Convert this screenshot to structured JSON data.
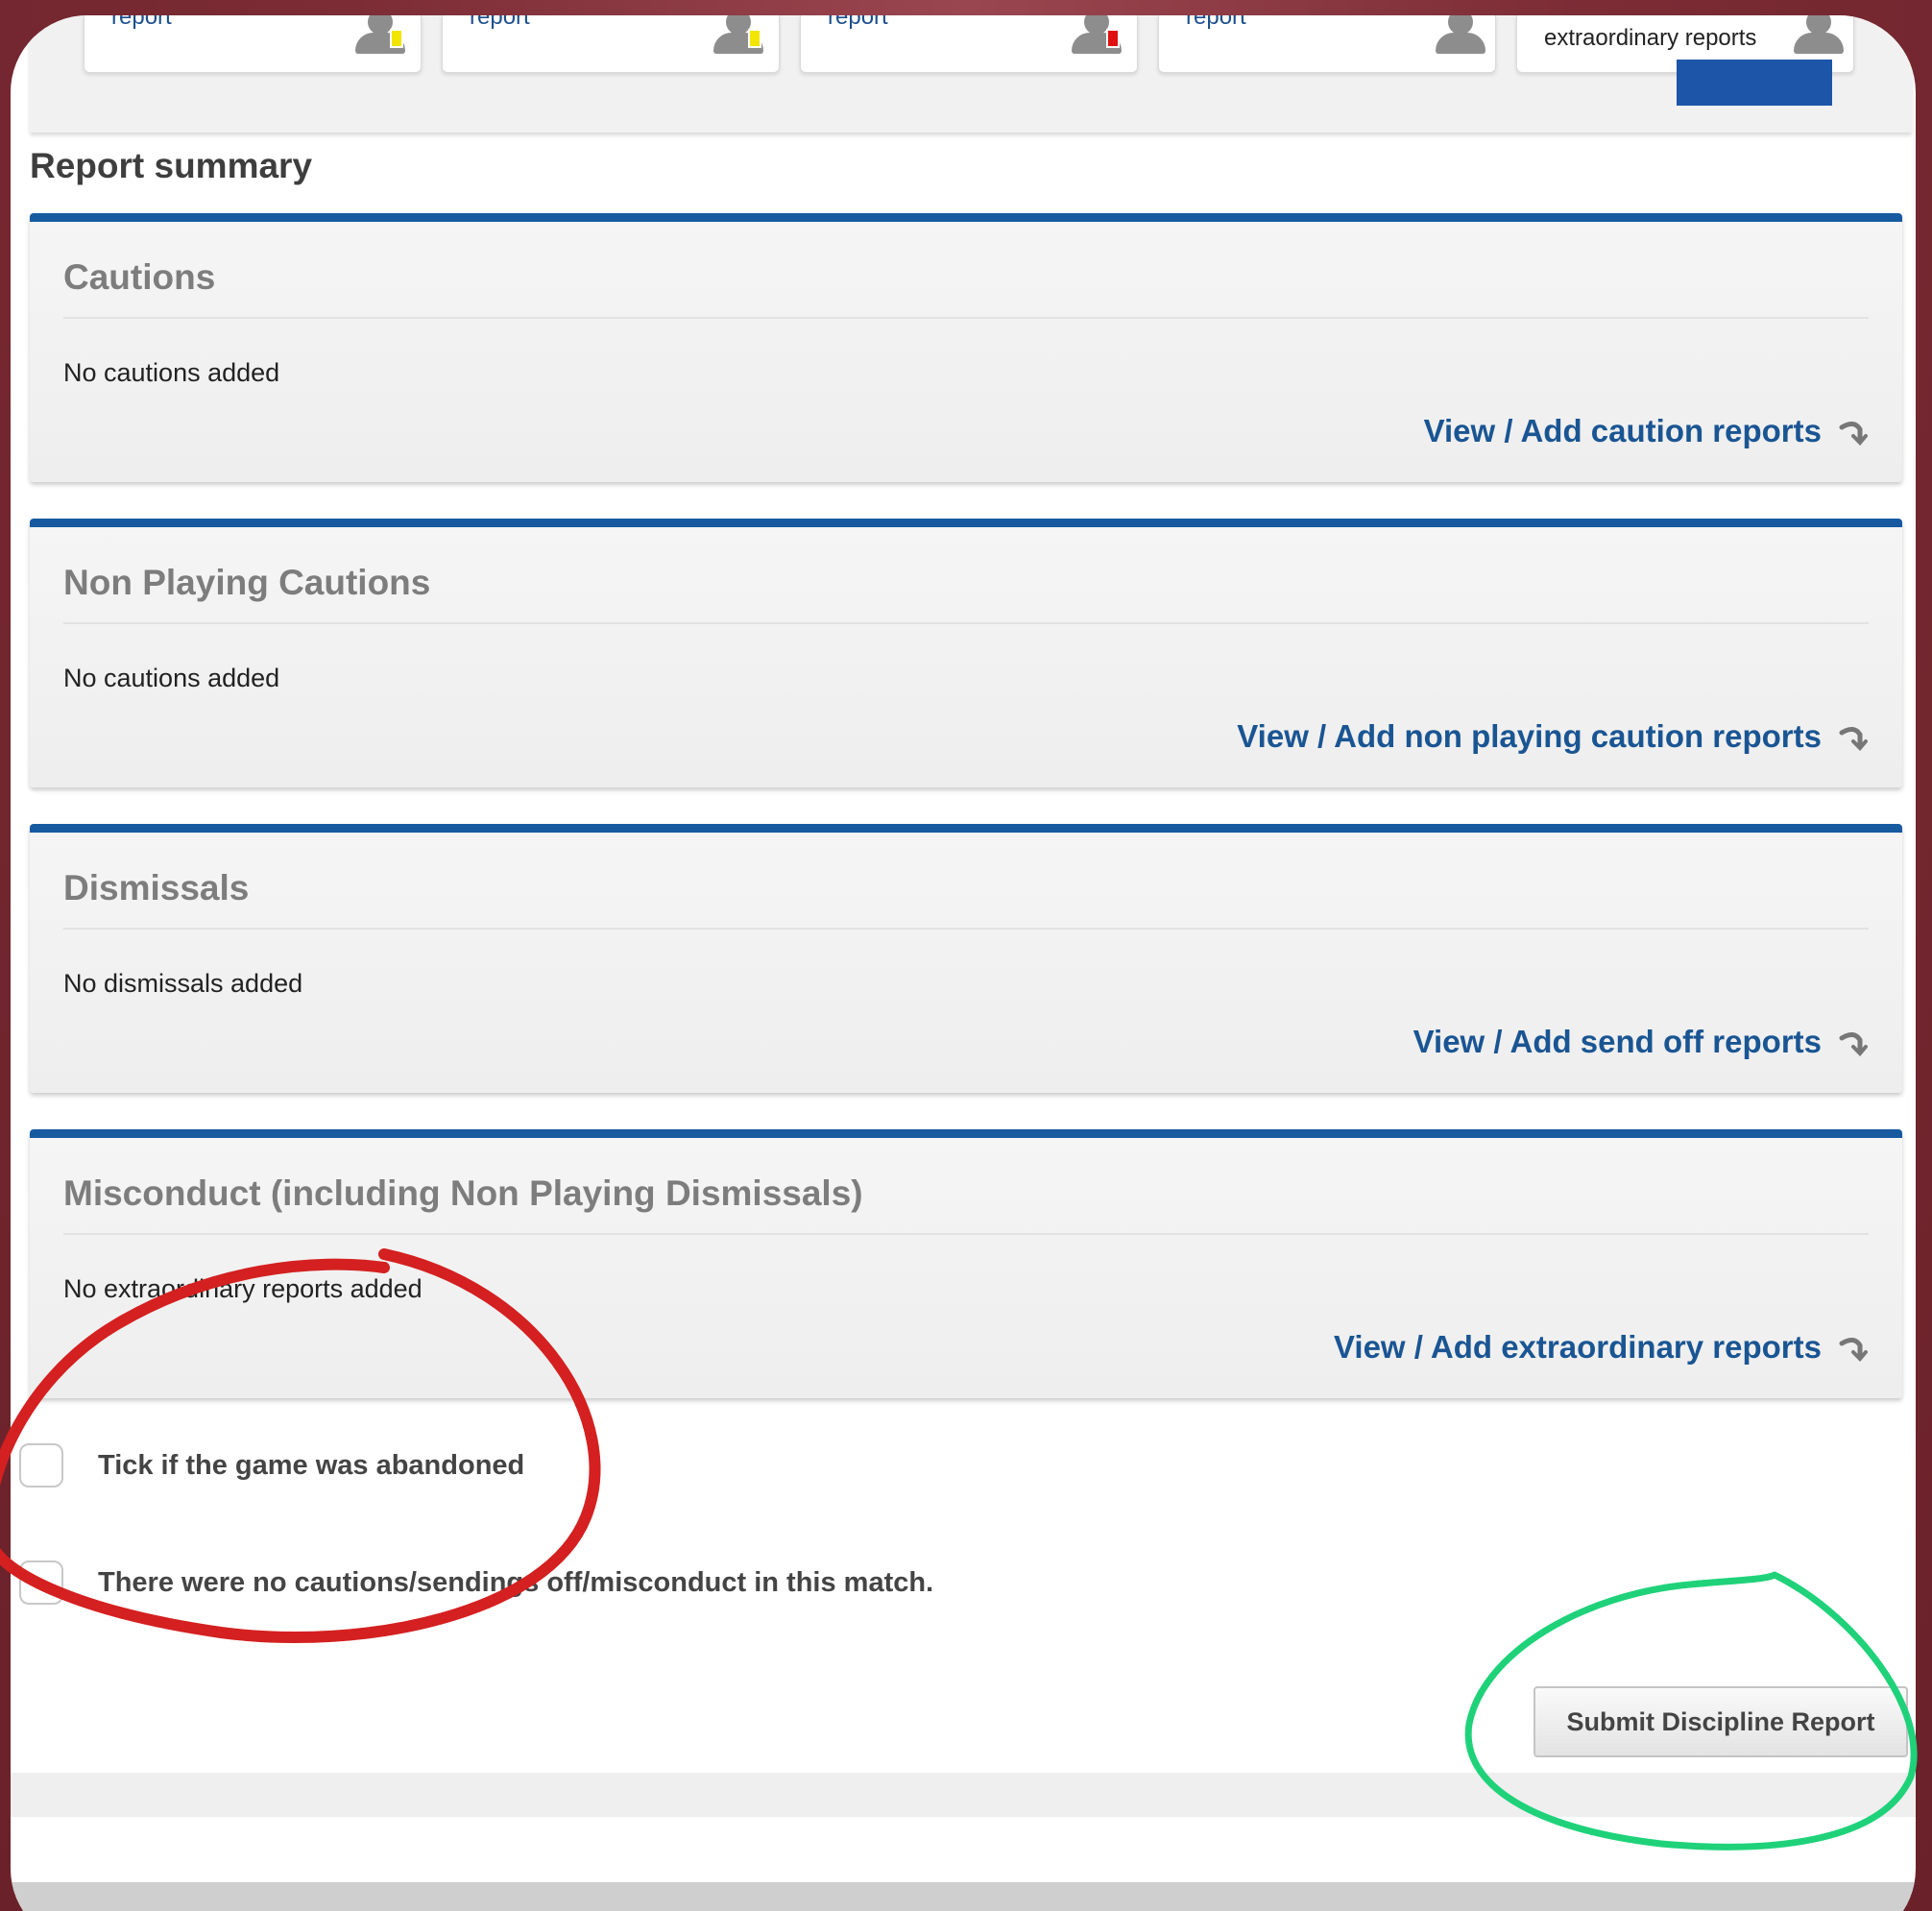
{
  "top_tiles": [
    {
      "label": "report",
      "card_color": "#f2e500"
    },
    {
      "label": "report",
      "card_color": "#f2e500"
    },
    {
      "label": "report",
      "card_color": "#e01010"
    },
    {
      "label": "report",
      "card_color": ""
    },
    {
      "label": "extraordinary reports",
      "card_color": ""
    }
  ],
  "page_title": "Report summary",
  "panels": [
    {
      "title": "Cautions",
      "empty_text": "No cautions added",
      "link": "View / Add caution reports"
    },
    {
      "title": "Non Playing Cautions",
      "empty_text": "No cautions added",
      "link": "View / Add non playing caution reports"
    },
    {
      "title": "Dismissals",
      "empty_text": "No dismissals added",
      "link": "View / Add send off reports"
    },
    {
      "title": "Misconduct (including Non Playing Dismissals)",
      "empty_text": "No extraordinary reports added",
      "link": "View / Add extraordinary reports"
    }
  ],
  "checkboxes": [
    {
      "label": "Tick if the game was abandoned",
      "checked": false
    },
    {
      "label": "There were no cautions/sendings off/misconduct in this match.",
      "checked": false
    }
  ],
  "submit_label": "Submit Discipline Report",
  "colors": {
    "accent": "#175aa0",
    "link": "#1a5593",
    "highlight_red": "#d42020",
    "highlight_green": "#1fd27a"
  }
}
